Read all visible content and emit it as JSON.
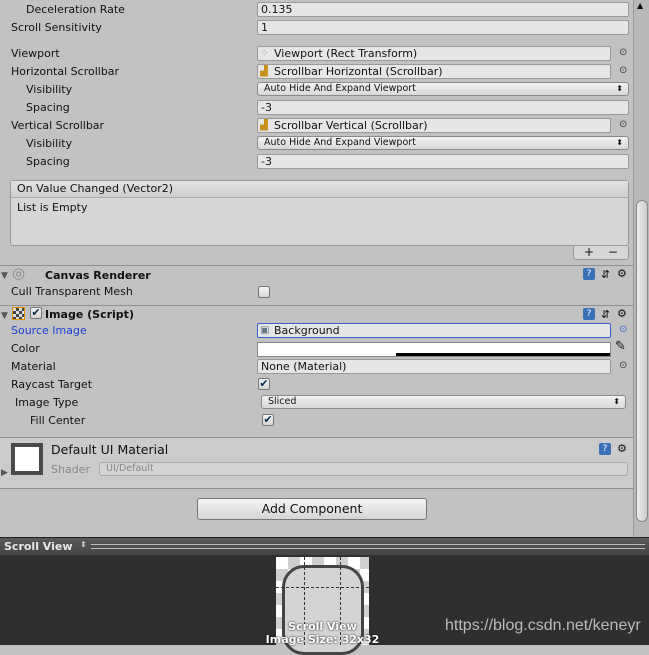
{
  "scroll_rect": {
    "deceleration_rate": {
      "label": "Deceleration Rate",
      "value": "0.135"
    },
    "scroll_sensitivity": {
      "label": "Scroll Sensitivity",
      "value": "1"
    },
    "viewport": {
      "label": "Viewport",
      "value": "Viewport (Rect Transform)"
    },
    "horizontal_scrollbar": {
      "label": "Horizontal Scrollbar",
      "value": "Scrollbar Horizontal (Scrollbar)"
    },
    "h_visibility": {
      "label": "Visibility",
      "value": "Auto Hide And Expand Viewport"
    },
    "h_spacing": {
      "label": "Spacing",
      "value": "-3"
    },
    "vertical_scrollbar": {
      "label": "Vertical Scrollbar",
      "value": "Scrollbar Vertical (Scrollbar)"
    },
    "v_visibility": {
      "label": "Visibility",
      "value": "Auto Hide And Expand Viewport"
    },
    "v_spacing": {
      "label": "Spacing",
      "value": "-3"
    },
    "event": {
      "title": "On Value Changed (Vector2)",
      "empty": "List is Empty",
      "add": "+",
      "remove": "−"
    }
  },
  "canvas_renderer": {
    "title": "Canvas Renderer",
    "cull_label": "Cull Transparent Mesh",
    "cull_checked": false
  },
  "image": {
    "title": "Image (Script)",
    "enabled": true,
    "source_image": {
      "label": "Source Image",
      "value": "Background"
    },
    "color": {
      "label": "Color",
      "value": "#ffffff"
    },
    "material": {
      "label": "Material",
      "value": "None (Material)"
    },
    "raycast": {
      "label": "Raycast Target",
      "checked": true
    },
    "image_type": {
      "label": "Image Type",
      "value": "Sliced"
    },
    "fill_center": {
      "label": "Fill Center",
      "checked": true
    }
  },
  "material_block": {
    "name": "Default UI Material",
    "shader_label": "Shader",
    "shader_value": "UI/Default"
  },
  "add_component": "Add Component",
  "preview": {
    "title": "Scroll View",
    "caption": "Scroll View",
    "size": "Image Size: 32x32",
    "watermark": "https://blog.csdn.net/keneyr"
  },
  "icons": {
    "check": "✔",
    "picker": "⊙",
    "dropdown": "⬍",
    "help": "?",
    "settings": "⚙",
    "foldout": "▼"
  }
}
